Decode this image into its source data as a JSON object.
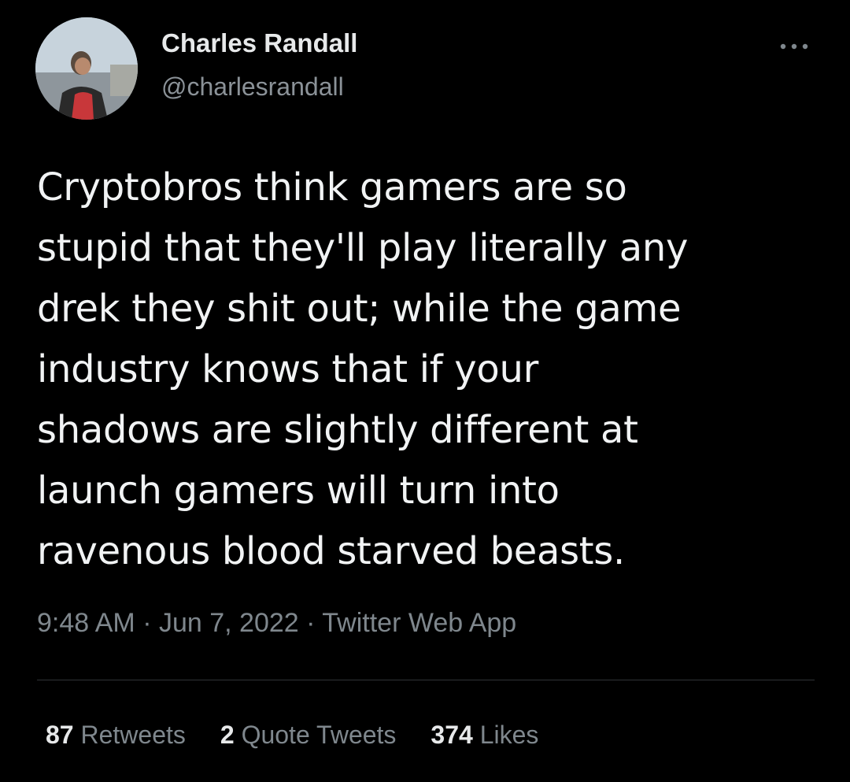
{
  "author": {
    "display_name": "Charles Randall",
    "handle": "@charlesrandall",
    "avatar_icon": "profile-photo"
  },
  "menu": {
    "icon": "more-horizontal-icon",
    "glyph": "···"
  },
  "tweet": {
    "lines": [
      "Cryptobros think gamers are so",
      "stupid that they'll play literally any",
      "drek they shit out; while the game",
      "industry knows that if your",
      "shadows are slightly different at",
      "launch gamers will turn into",
      "ravenous blood starved beasts."
    ]
  },
  "meta": {
    "time": "9:48 AM",
    "separator": " · ",
    "date": "Jun 7, 2022",
    "source": "Twitter Web App"
  },
  "stats": {
    "retweets_count": "87",
    "retweets_label": " Retweets",
    "quotes_count": "2",
    "quotes_label": " Quote Tweets",
    "likes_count": "374",
    "likes_label": " Likes"
  },
  "colors": {
    "background": "#000000",
    "primary_text": "#e7e9ea",
    "secondary_text": "#7f878d",
    "divider": "#2f3336"
  }
}
